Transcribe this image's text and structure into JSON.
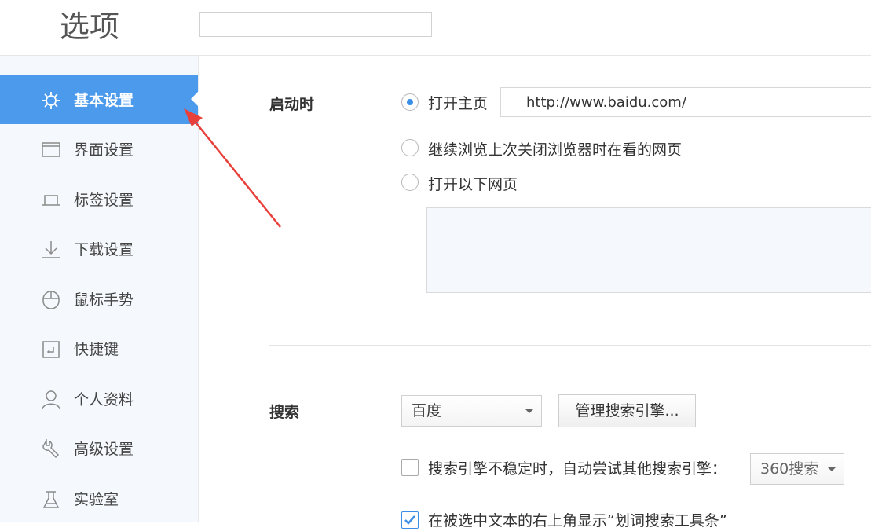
{
  "header": {
    "title": "选项",
    "search_value": "",
    "search_placeholder": ""
  },
  "sidebar": {
    "items": [
      {
        "label": "基本设置",
        "icon": "gear-icon",
        "active": true
      },
      {
        "label": "界面设置",
        "icon": "window-icon",
        "active": false
      },
      {
        "label": "标签设置",
        "icon": "tab-icon",
        "active": false
      },
      {
        "label": "下载设置",
        "icon": "download-icon",
        "active": false
      },
      {
        "label": "鼠标手势",
        "icon": "mouse-icon",
        "active": false
      },
      {
        "label": "快捷键",
        "icon": "shortcut-icon",
        "active": false
      },
      {
        "label": "个人资料",
        "icon": "user-icon",
        "active": false
      },
      {
        "label": "高级设置",
        "icon": "wrench-icon",
        "active": false
      },
      {
        "label": "实验室",
        "icon": "flask-icon",
        "active": false
      }
    ]
  },
  "startup": {
    "title": "启动时",
    "options": [
      {
        "label": "打开主页",
        "checked": true
      },
      {
        "label": "继续浏览上次关闭浏览器时在看的网页",
        "checked": false
      },
      {
        "label": "打开以下网页",
        "checked": false
      }
    ],
    "homepage_url": "http://www.baidu.com/"
  },
  "search": {
    "title": "搜索",
    "engine_selected": "百度",
    "manage_button": "管理搜索引擎...",
    "fallback_label": "搜索引擎不稳定时，自动尝试其他搜索引擎：",
    "fallback_selected": "360搜索",
    "fallback_checked": false,
    "toolbar_label": "在被选中文本的右上角显示“划词搜索工具条”",
    "toolbar_checked": true
  },
  "colors": {
    "accent": "#4c9aec",
    "annotation_arrow": "#e8413c"
  }
}
